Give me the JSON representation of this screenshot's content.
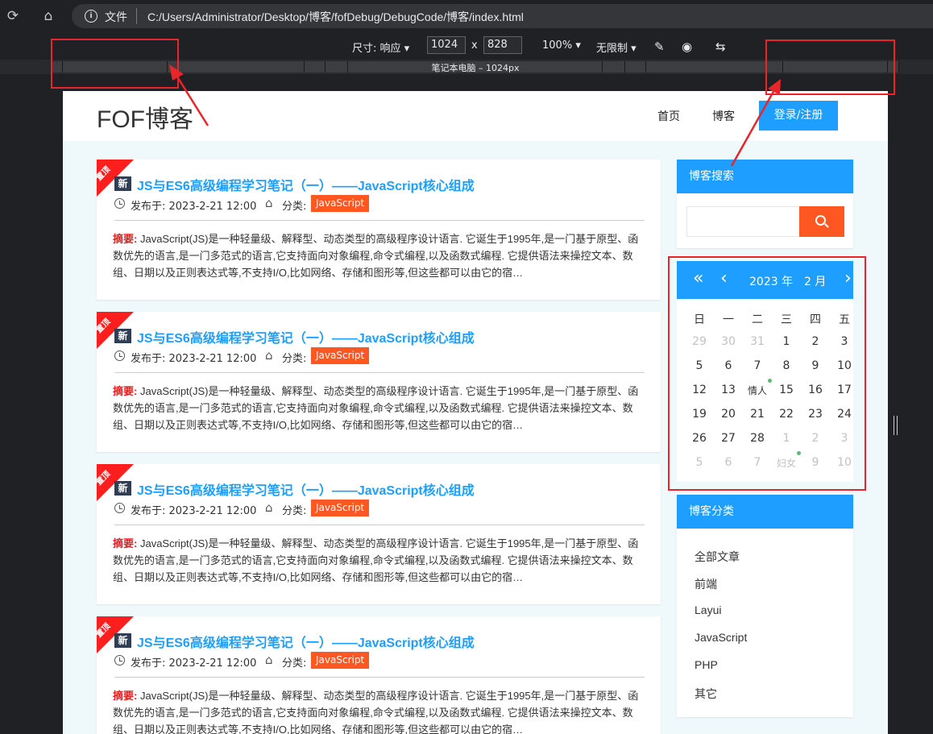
{
  "browser": {
    "file_label": "文件",
    "url": "C:/Users/Administrator/Desktop/博客/fofDebug/DebugCode/博客/index.html",
    "size_label": "尺寸: 响应",
    "width_value": "1024",
    "times": "x",
    "height_value": "828",
    "zoom": "100%",
    "throttle": "无限制",
    "ruler_label": "笔记本电脑 – 1024px"
  },
  "site": {
    "logo": "FOF博客",
    "nav": [
      "首页",
      "博客"
    ],
    "login": "登录/注册"
  },
  "articles": [
    {
      "ribbon": "置顶",
      "new": "新",
      "title": "JS与ES6高级编程学习笔记（一）——JavaScript核心组成",
      "date": "发布于: 2023-2-21 12:00",
      "cat_label": "分类:",
      "category": "JavaScript",
      "summary_label": "摘要:",
      "summary": "JavaScript(JS)是一种轻量级、解释型、动态类型的高级程序设计语言. 它诞生于1995年,是一门基于原型、函数优先的语言,是一门多范式的语言,它支持面向对象编程,命令式编程,以及函数式编程. 它提供语法来操控文本、数组、日期以及正则表达式等,不支持I/O,比如网络、存储和图形等,但这些都可以由它的宿…"
    },
    {
      "ribbon": "置顶",
      "new": "新",
      "title": "JS与ES6高级编程学习笔记（一）——JavaScript核心组成",
      "date": "发布于: 2023-2-21 12:00",
      "cat_label": "分类:",
      "category": "JavaScript",
      "summary_label": "摘要:",
      "summary": "JavaScript(JS)是一种轻量级、解释型、动态类型的高级程序设计语言. 它诞生于1995年,是一门基于原型、函数优先的语言,是一门多范式的语言,它支持面向对象编程,命令式编程,以及函数式编程. 它提供语法来操控文本、数组、日期以及正则表达式等,不支持I/O,比如网络、存储和图形等,但这些都可以由它的宿…"
    },
    {
      "ribbon": "置顶",
      "new": "新",
      "title": "JS与ES6高级编程学习笔记（一）——JavaScript核心组成",
      "date": "发布于: 2023-2-21 12:00",
      "cat_label": "分类:",
      "category": "JavaScript",
      "summary_label": "摘要:",
      "summary": "JavaScript(JS)是一种轻量级、解释型、动态类型的高级程序设计语言. 它诞生于1995年,是一门基于原型、函数优先的语言,是一门多范式的语言,它支持面向对象编程,命令式编程,以及函数式编程. 它提供语法来操控文本、数组、日期以及正则表达式等,不支持I/O,比如网络、存储和图形等,但这些都可以由它的宿…"
    },
    {
      "ribbon": "置顶",
      "new": "新",
      "title": "JS与ES6高级编程学习笔记（一）——JavaScript核心组成",
      "date": "发布于: 2023-2-21 12:00",
      "cat_label": "分类:",
      "category": "JavaScript",
      "summary_label": "摘要:",
      "summary": "JavaScript(JS)是一种轻量级、解释型、动态类型的高级程序设计语言. 它诞生于1995年,是一门基于原型、函数优先的语言,是一门多范式的语言,它支持面向对象编程,命令式编程,以及函数式编程. 它提供语法来操控文本、数组、日期以及正则表达式等,不支持I/O,比如网络、存储和图形等,但这些都可以由它的宿…"
    }
  ],
  "search": {
    "title": "博客搜索"
  },
  "calendar": {
    "year": "2023 年",
    "month": "2 月",
    "weekdays": [
      "日",
      "一",
      "二",
      "三",
      "四",
      "五"
    ],
    "rows": [
      [
        {
          "t": "29",
          "dim": true
        },
        {
          "t": "30",
          "dim": true
        },
        {
          "t": "31",
          "dim": true
        },
        {
          "t": "1"
        },
        {
          "t": "2"
        },
        {
          "t": "3"
        }
      ],
      [
        {
          "t": "5"
        },
        {
          "t": "6"
        },
        {
          "t": "7"
        },
        {
          "t": "8"
        },
        {
          "t": "9"
        },
        {
          "t": "10"
        }
      ],
      [
        {
          "t": "12"
        },
        {
          "t": "13"
        },
        {
          "t": "情人",
          "mark": true
        },
        {
          "t": "15"
        },
        {
          "t": "16"
        },
        {
          "t": "17"
        }
      ],
      [
        {
          "t": "19"
        },
        {
          "t": "20"
        },
        {
          "t": "21"
        },
        {
          "t": "22"
        },
        {
          "t": "23"
        },
        {
          "t": "24"
        }
      ],
      [
        {
          "t": "26"
        },
        {
          "t": "27"
        },
        {
          "t": "28"
        },
        {
          "t": "1",
          "dim": true
        },
        {
          "t": "2",
          "dim": true
        },
        {
          "t": "3",
          "dim": true
        }
      ],
      [
        {
          "t": "5",
          "dim": true
        },
        {
          "t": "6",
          "dim": true
        },
        {
          "t": "7",
          "dim": true
        },
        {
          "t": "妇女",
          "dim": true,
          "mark": true
        },
        {
          "t": "9",
          "dim": true
        },
        {
          "t": "10",
          "dim": true
        }
      ]
    ]
  },
  "categories": {
    "title": "博客分类",
    "items": [
      "全部文章",
      "前端",
      "Layui",
      "JavaScript",
      "PHP",
      "其它"
    ]
  },
  "colors": {
    "accent": "#1e9fff",
    "orange": "#ff5722",
    "annotation": "#e8262a"
  }
}
